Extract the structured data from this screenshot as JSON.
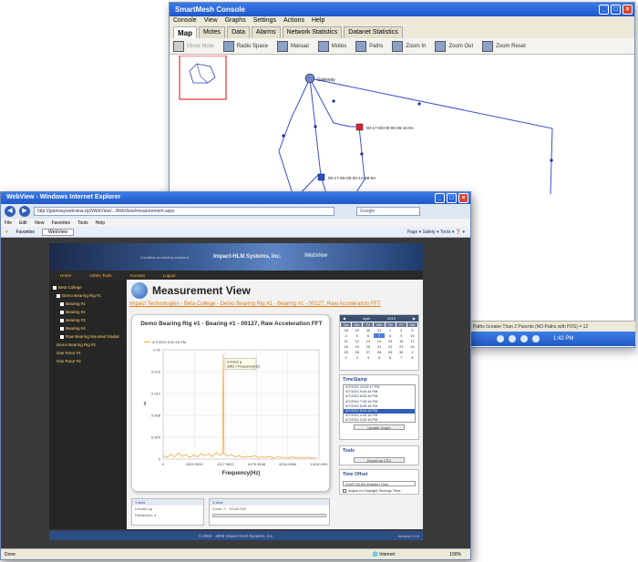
{
  "console": {
    "title": "SmartMesh Console",
    "menu": [
      "Console",
      "View",
      "Graphs",
      "Settings",
      "Actions",
      "Help"
    ],
    "tabs": [
      "Map",
      "Motes",
      "Data",
      "Alarms",
      "Network Statistics",
      "Datanet Statistics"
    ],
    "toolbar": [
      "Move Mote",
      "Radio Space",
      "Manual",
      "Motes",
      "Paths",
      "Zoom In",
      "Zoom Out",
      "Zoom Reset"
    ],
    "map_nodes": [
      "Gateway",
      "00-17-0D-00-00-25-16-9A",
      "00-17-0D-00-00-1A-68-9A"
    ],
    "status_text": "Paths Greater Than 2 Parents (NO Paths with PDS) = 12",
    "taskbar_clock": "1:42 PM"
  },
  "browser": {
    "title": "WebView - Windows Internet Explorer",
    "url": "http://gatewaywebview.zip/WebView/...WebView/measurement.aspx",
    "search_placeholder": "Google",
    "menu": [
      "File",
      "Edit",
      "View",
      "Favorites",
      "Tools",
      "Help"
    ],
    "favorites_label": "Favorites",
    "tab_label": "WebView",
    "commands": "Page ▾  Safety ▾  Tools ▾  ❓ ▾",
    "status_left": "Done",
    "status_zone": "Internet",
    "status_zoom": "100%"
  },
  "webview": {
    "header_company": "Impact-HLM Systems, Inc.",
    "header_tagline": "Condition monitoring solutions",
    "header_brand": "WebView",
    "nav": [
      "Home",
      "Admin Tools",
      "Account",
      "Logout"
    ],
    "tree": [
      "Beta College",
      "Demo Bearing Rig #1",
      "Bearing #1",
      "Bearing #2",
      "Bearing #3",
      "Bearing #4",
      "Raw Bearing Mounted Radial",
      "Demo Bearing Rig #2",
      "Gas Rotor #1",
      "Gas Rotor #2"
    ],
    "page_title": "Measurement View",
    "breadcrumb": "Impact Technologies - Beta College - Demo Bearing Rig #1 - Bearing #1 - 00127, Raw Acceleration FFT",
    "footer": "© 2002 - 2008 Impact-HLM Systems, Inc.",
    "footer_version": "Version 2.0.0"
  },
  "chart_data": {
    "type": "line",
    "title": "Demo Bearing Rig #1 - Bearing #1 - 00127, Raw Acceleration FFT",
    "legend": "4/7/2010 5:00:16 PM",
    "xlabel": "Frequency(Hz)",
    "ylabel": "g",
    "xlim": [
      0,
      10240
    ],
    "ylim": [
      0,
      0.02
    ],
    "x_ticks": [
      "0",
      "2003.9000",
      "4117.9822",
      "6175.9648",
      "8234.6084",
      "10240.000"
    ],
    "y_ticks": [
      "0",
      "0.004",
      "0.008",
      "0.012",
      "0.016",
      "0.02"
    ],
    "tooltip": [
      "0.01912 g",
      "3951.7 Frequency(Hz)"
    ],
    "series": [
      {
        "name": "4/7/2010 5:00:16 PM",
        "x": [
          0,
          250,
          500,
          750,
          1000,
          1250,
          1500,
          1750,
          2000,
          2250,
          2500,
          2750,
          3000,
          3250,
          3500,
          3750,
          3900,
          3951.7,
          4000,
          4250,
          4500,
          4750,
          5000,
          5250,
          5500,
          5750,
          6000,
          6250,
          6500,
          6750,
          7000,
          7250,
          7500,
          7750,
          8000,
          8250,
          8500,
          8750,
          9000,
          9250,
          9500,
          9750,
          10000
        ],
        "y": [
          0.0006,
          0.0003,
          0.0009,
          0.0004,
          0.0011,
          0.0005,
          0.0008,
          0.0003,
          0.0007,
          0.0004,
          0.001,
          0.0006,
          0.0009,
          0.0005,
          0.0012,
          0.0007,
          0.0011,
          0.01912,
          0.0009,
          0.0006,
          0.0008,
          0.0004,
          0.0006,
          0.0003,
          0.0005,
          0.0004,
          0.0006,
          0.0003,
          0.0004,
          0.0003,
          0.0005,
          0.0002,
          0.0004,
          0.0003,
          0.0003,
          0.0002,
          0.0004,
          0.0002,
          0.0003,
          0.0002,
          0.0003,
          0.0002,
          0.0002
        ]
      }
    ]
  },
  "calendar": {
    "month": "April",
    "year": "2010",
    "dow": [
      "Su",
      "Mo",
      "Tu",
      "We",
      "Th",
      "Fr",
      "Sa"
    ],
    "days": [
      "28",
      "29",
      "30",
      "31",
      "1",
      "2",
      "3",
      "4",
      "5",
      "6",
      "7",
      "8",
      "9",
      "10",
      "11",
      "12",
      "13",
      "14",
      "15",
      "16",
      "17",
      "18",
      "19",
      "20",
      "21",
      "22",
      "23",
      "24",
      "25",
      "26",
      "27",
      "28",
      "29",
      "30",
      "1",
      "2",
      "3",
      "4",
      "5",
      "6",
      "7",
      "8"
    ],
    "selected": "7"
  },
  "timestamp": {
    "title": "TimeStamp",
    "items": [
      "4/7/2010 10:00:17 PM",
      "4/7/2010 9:00:16 PM",
      "4/7/2010 8:00:16 PM",
      "4/7/2010 7:00:16 PM",
      "4/7/2010 6:00:16 PM",
      "4/7/2010 5:00:16 PM",
      "4/7/2010 4:00:16 PM",
      "4/7/2010 3:00:16 PM"
    ],
    "selected_index": 5,
    "button": "Update Graph"
  },
  "tools": {
    "title": "Tools",
    "button": "Export as CSV"
  },
  "time_offset": {
    "title": "Time Offset",
    "selected": "(GMT-05:00) Eastern Time",
    "checkbox": "Adjust for Daylight Savings Time"
  },
  "lower_panels": [
    {
      "title": "Y-Axis",
      "row1": "Linear/Log",
      "row2": "Resolution: 4"
    },
    {
      "title": "X-Axis",
      "row1": "Zoom: 0",
      "row2": "10240.000"
    }
  ]
}
